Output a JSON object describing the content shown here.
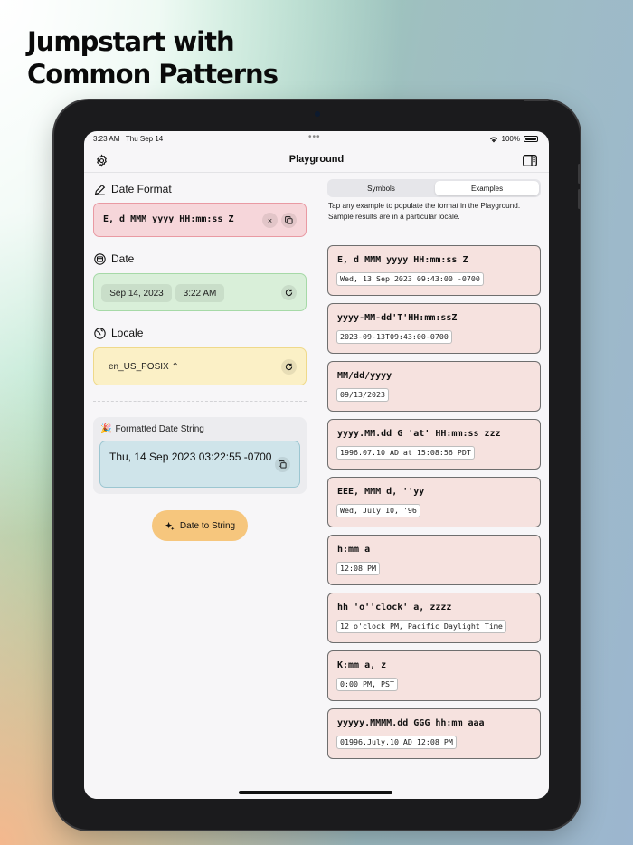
{
  "headline": {
    "line1": "Jumpstart with",
    "line2": "Common Patterns"
  },
  "status_bar": {
    "time": "3:23 AM",
    "date": "Thu Sep 14",
    "battery": "100%"
  },
  "navbar": {
    "title": "Playground",
    "settings_icon": "gear-icon",
    "sidebar_icon": "sidebar-toggle-icon"
  },
  "left": {
    "date_format": {
      "label": "Date Format",
      "value": "E, d MMM yyyy HH:mm:ss Z",
      "clear_icon": "×"
    },
    "date": {
      "label": "Date",
      "date_value": "Sep 14, 2023",
      "time_value": "3:22 AM"
    },
    "locale": {
      "label": "Locale",
      "value": "en_US_POSIX ⌃"
    },
    "result": {
      "label": "Formatted Date String",
      "value": "Thu, 14 Sep 2023 03:22:55 -0700"
    },
    "cta": {
      "label": "Date to String"
    }
  },
  "right": {
    "tabs": [
      {
        "label": "Symbols"
      },
      {
        "label": "Examples"
      }
    ],
    "active_tab": "Examples",
    "help": "Tap any example to populate the format in the Playground.\nSample results are in a particular locale.",
    "examples": [
      {
        "pattern": "E, d MMM yyyy HH:mm:ss Z",
        "result": "Wed, 13 Sep 2023 09:43:00 -0700"
      },
      {
        "pattern": "yyyy-MM-dd'T'HH:mm:ssZ",
        "result": "2023-09-13T09:43:00-0700"
      },
      {
        "pattern": "MM/dd/yyyy",
        "result": "09/13/2023"
      },
      {
        "pattern": "yyyy.MM.dd G 'at' HH:mm:ss zzz",
        "result": "1996.07.10 AD at 15:08:56 PDT"
      },
      {
        "pattern": "EEE, MMM d, ''yy",
        "result": "Wed, July 10, '96"
      },
      {
        "pattern": "h:mm a",
        "result": "12:08 PM"
      },
      {
        "pattern": "hh 'o''clock' a, zzzz",
        "result": "12 o'clock PM, Pacific Daylight Time"
      },
      {
        "pattern": "K:mm a, z",
        "result": "0:00 PM, PST"
      },
      {
        "pattern": "yyyyy.MMMM.dd GGG hh:mm aaa",
        "result": "01996.July.10 AD 12:08 PM"
      }
    ]
  },
  "colors": {
    "format_field": "#f6d6da",
    "date_field": "#d9efd9",
    "locale_field": "#fbf0c6",
    "result_field": "#cfe4ea",
    "cta": "#f6c67d",
    "example_card": "#f6e2df"
  }
}
